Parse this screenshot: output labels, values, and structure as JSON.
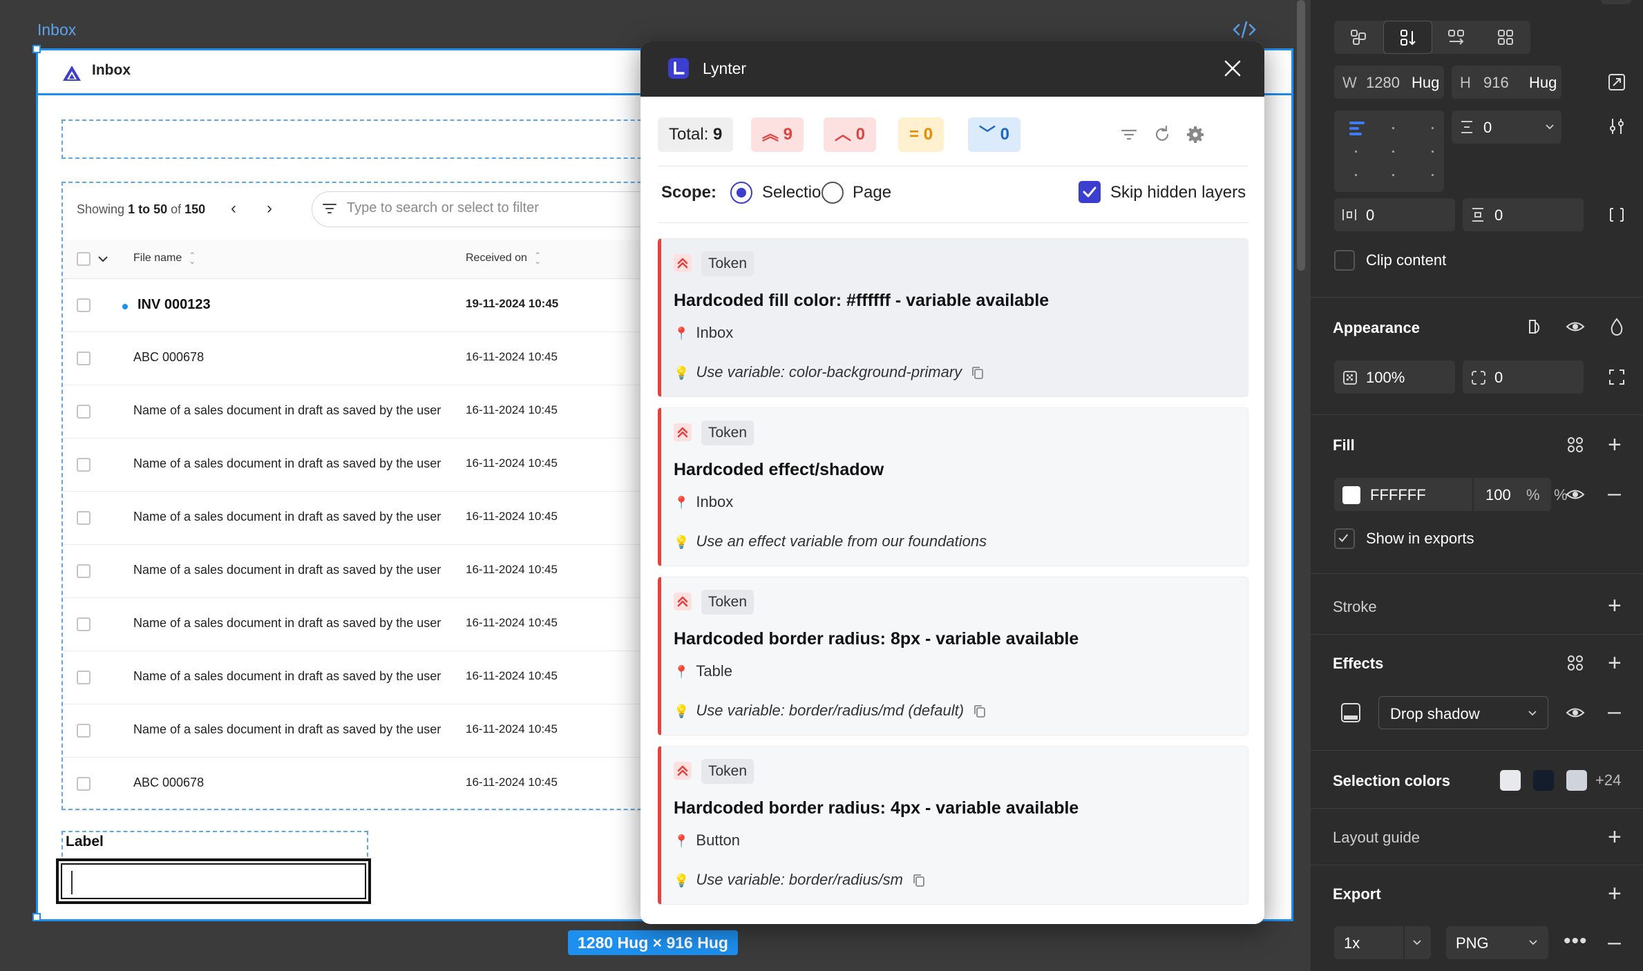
{
  "canvas": {
    "frame_label": "Inbox",
    "size_badge": "1280 Hug × 916 Hug"
  },
  "app": {
    "title": "Inbox",
    "showing_prefix": "Showing",
    "showing_range": "1 to 50",
    "showing_of": "of",
    "showing_total": "150",
    "search_placeholder": "Type to search or select to filter",
    "columns": [
      "File name",
      "Received on"
    ],
    "rows": [
      {
        "name": "INV 000123",
        "date": "19-11-2024 10:45",
        "unread": true
      },
      {
        "name": "ABC 000678",
        "date": "16-11-2024 10:45",
        "unread": false
      },
      {
        "name": "Name of a sales document in draft as saved by the user",
        "date": "16-11-2024 10:45",
        "unread": false
      },
      {
        "name": "Name of a sales document in draft as saved by the user",
        "date": "16-11-2024 10:45",
        "unread": false
      },
      {
        "name": "Name of a sales document in draft as saved by the user",
        "date": "16-11-2024 10:45",
        "unread": false
      },
      {
        "name": "Name of a sales document in draft as saved by the user",
        "date": "16-11-2024 10:45",
        "unread": false
      },
      {
        "name": "Name of a sales document in draft as saved by the user",
        "date": "16-11-2024 10:45",
        "unread": false
      },
      {
        "name": "Name of a sales document in draft as saved by the user",
        "date": "16-11-2024 10:45",
        "unread": false
      },
      {
        "name": "Name of a sales document in draft as saved by the user",
        "date": "16-11-2024 10:45",
        "unread": false
      },
      {
        "name": "ABC 000678",
        "date": "16-11-2024 10:45",
        "unread": false
      }
    ],
    "field_label": "Label"
  },
  "plugin": {
    "title": "Lynter",
    "stats": {
      "total_label": "Total:",
      "total": "9",
      "high": "9",
      "medium": "0",
      "low": "0",
      "info": "0"
    },
    "scope_label": "Scope:",
    "scope_options": [
      "Selection",
      "Page"
    ],
    "scope_selected": "Selection",
    "skip_hidden_label": "Skip hidden layers",
    "skip_hidden_checked": true,
    "issues": [
      {
        "tag": "Token",
        "title": "Hardcoded fill color: #ffffff - variable available",
        "location": "Inbox",
        "tip": "Use variable: color-background-primary",
        "copy": true
      },
      {
        "tag": "Token",
        "title": "Hardcoded effect/shadow",
        "location": "Inbox",
        "tip": "Use an effect variable from our foundations",
        "copy": false
      },
      {
        "tag": "Token",
        "title": "Hardcoded border radius: 8px - variable available",
        "location": "Table",
        "tip": "Use variable: border/radius/md (default)",
        "copy": true
      },
      {
        "tag": "Token",
        "title": "Hardcoded border radius: 4px - variable available",
        "location": "Button",
        "tip": "Use variable: border/radius/sm",
        "copy": true
      }
    ],
    "colors": {
      "accent": "#3b3ecf",
      "error": "#e0443e",
      "warning": "#e88b00",
      "info": "#2068c6"
    }
  },
  "properties": {
    "width_label": "W",
    "width": "1280",
    "width_mode": "Hug",
    "height_label": "H",
    "height": "916",
    "height_mode": "Hug",
    "gap": "0",
    "padding_h": "0",
    "padding_v": "0",
    "clip_content": "Clip content",
    "appearance_title": "Appearance",
    "opacity": "100%",
    "corner_radius": "0",
    "fill_title": "Fill",
    "fill_hex": "FFFFFF",
    "fill_opacity": "100",
    "fill_pct": "%",
    "show_in_exports": "Show in exports",
    "stroke_title": "Stroke",
    "effects_title": "Effects",
    "effect_type": "Drop shadow",
    "selection_colors_title": "Selection colors",
    "selection_colors": [
      "#e8e9ec",
      "#141d2b",
      "#cfd3dc"
    ],
    "selection_colors_more": "+24",
    "layout_guide_title": "Layout guide",
    "export_title": "Export",
    "export_scale": "1x",
    "export_format": "PNG"
  }
}
